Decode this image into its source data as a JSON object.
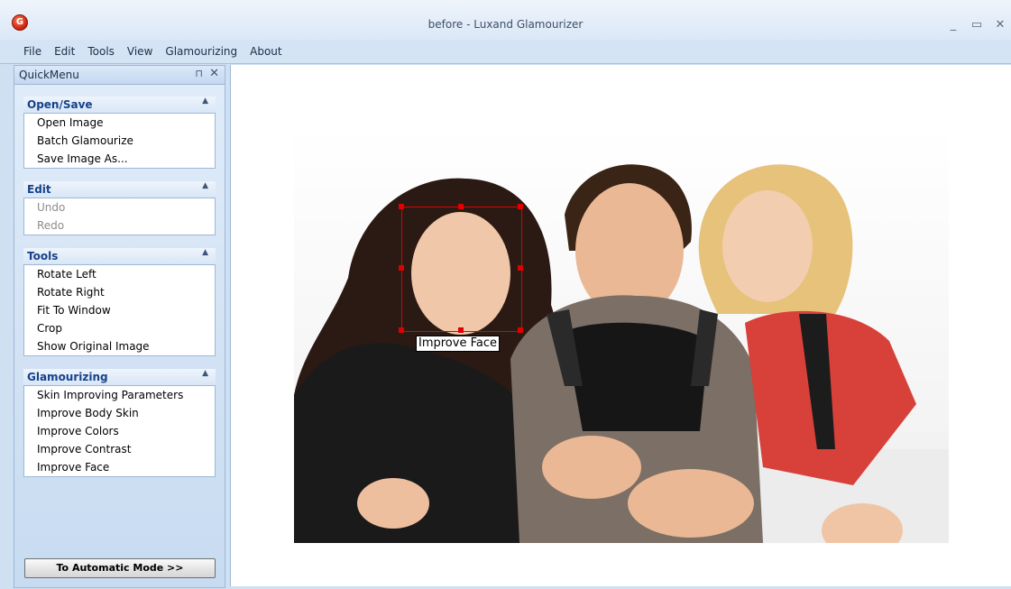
{
  "window": {
    "title": "before - Luxand Glamourizer",
    "icon": "app-logo-icon"
  },
  "menu": [
    "File",
    "Edit",
    "Tools",
    "View",
    "Glamourizing",
    "About"
  ],
  "quickmenu": {
    "title": "QuickMenu",
    "groups": [
      {
        "title": "Open/Save",
        "items": [
          {
            "label": "Open Image",
            "enabled": true
          },
          {
            "label": "Batch Glamourize",
            "enabled": true
          },
          {
            "label": "Save Image As...",
            "enabled": true
          }
        ]
      },
      {
        "title": "Edit",
        "items": [
          {
            "label": "Undo",
            "enabled": false
          },
          {
            "label": "Redo",
            "enabled": false
          }
        ]
      },
      {
        "title": "Tools",
        "items": [
          {
            "label": "Rotate Left",
            "enabled": true
          },
          {
            "label": "Rotate Right",
            "enabled": true
          },
          {
            "label": "Fit To Window",
            "enabled": true
          },
          {
            "label": "Crop",
            "enabled": true
          },
          {
            "label": "Show Original Image",
            "enabled": true
          }
        ]
      },
      {
        "title": "Glamourizing",
        "items": [
          {
            "label": "Skin Improving Parameters",
            "enabled": true
          },
          {
            "label": "Improve Body Skin",
            "enabled": true
          },
          {
            "label": "Improve Colors",
            "enabled": true
          },
          {
            "label": "Improve Contrast",
            "enabled": true
          },
          {
            "label": "Improve Face",
            "enabled": true
          }
        ]
      }
    ],
    "auto_mode_button": "To Automatic Mode >>"
  },
  "canvas": {
    "face_label": "Improve Face",
    "selection_color": "#e00000"
  }
}
